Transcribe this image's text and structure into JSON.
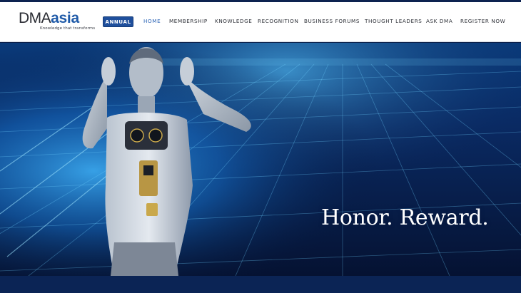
{
  "brand": {
    "name_part1": "DMA",
    "name_part2": "asia",
    "tagline": "Knowledge that transforms"
  },
  "header": {
    "annual_label": "ANNUAL"
  },
  "nav": {
    "items": [
      {
        "label": "HOME",
        "active": true
      },
      {
        "label": "MEMBERSHIP",
        "active": false
      },
      {
        "label": "KNOWLEDGE",
        "active": false
      },
      {
        "label": "RECOGNITION",
        "active": false
      },
      {
        "label": "BUSINESS FORUMS",
        "active": false
      },
      {
        "label": "THOUGHT LEADERS",
        "active": false
      },
      {
        "label": "ASK DMA",
        "active": false
      },
      {
        "label": "REGISTER NOW",
        "active": false
      }
    ]
  },
  "hero": {
    "headline": "Honor. Reward."
  },
  "colors": {
    "brand_blue": "#1f5aa8",
    "nav_active": "#2a63b5",
    "button_blue": "#1f4f9c",
    "hero_dark": "#06163a",
    "footer_band": "#0b2455"
  }
}
